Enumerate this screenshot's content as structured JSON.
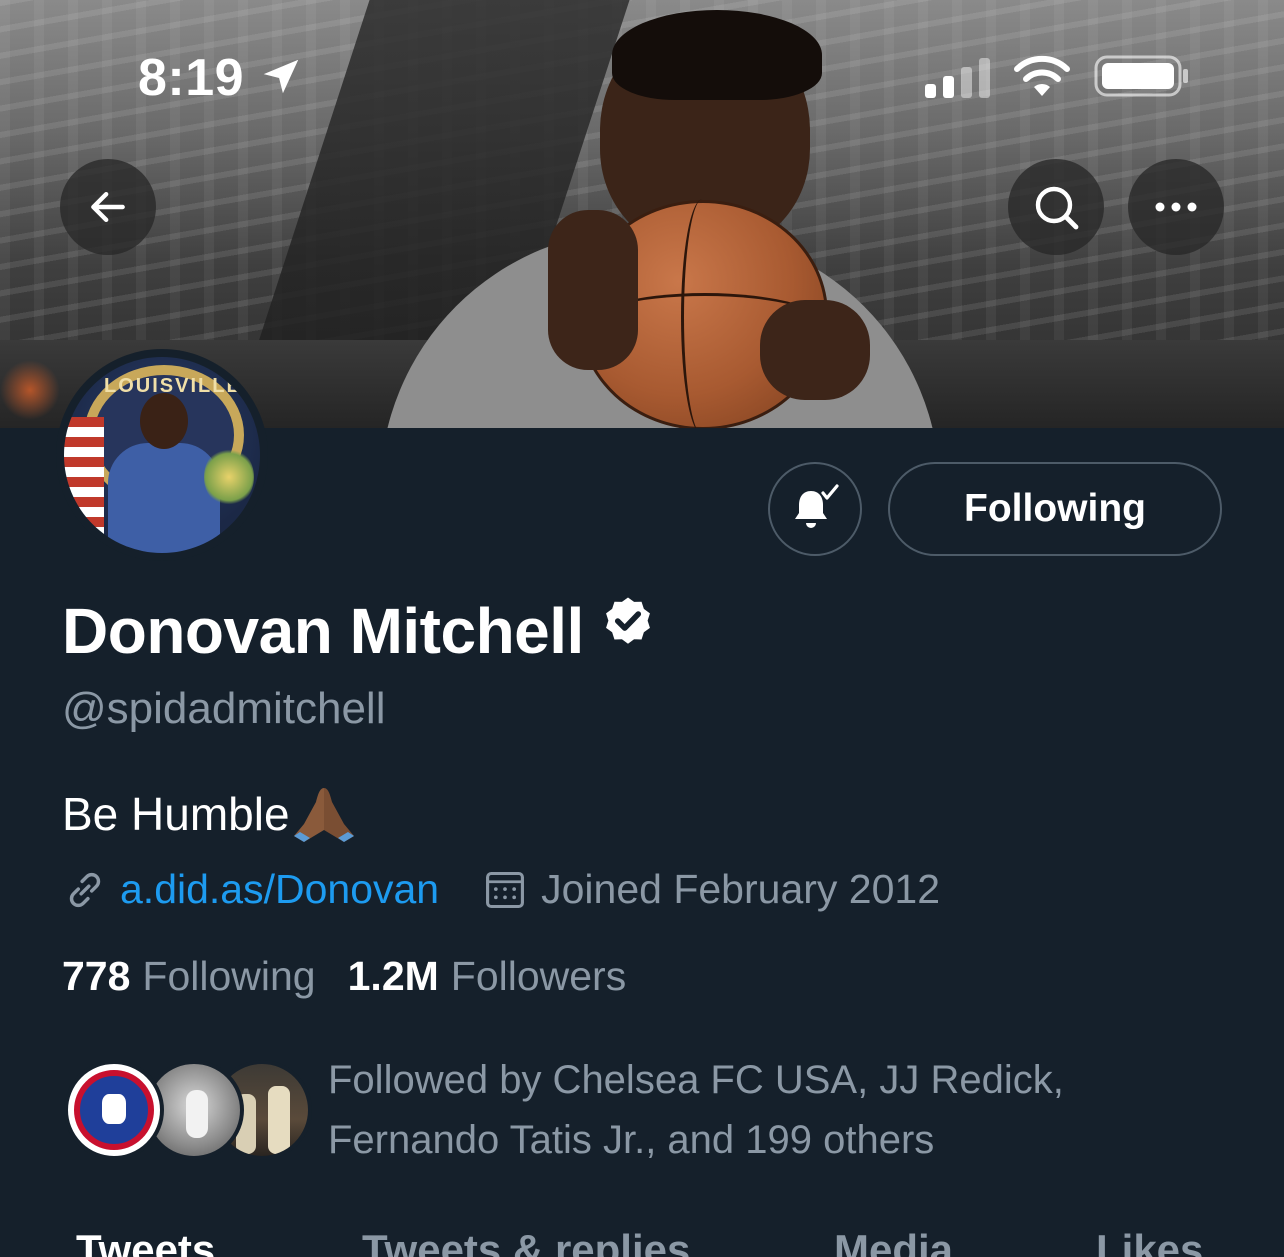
{
  "status_bar": {
    "time": "8:19"
  },
  "profile": {
    "display_name": "Donovan Mitchell",
    "handle": "@spidadmitchell",
    "bio": "Be Humble",
    "bio_emoji": "praying-hands-emoji",
    "website": "a.did.as/Donovan",
    "joined": "Joined February 2012",
    "following_count": "778",
    "following_label": "Following",
    "followers_count": "1.2M",
    "followers_label": "Followers",
    "followed_by": "Followed by Chelsea FC USA, JJ Redick, Fernando Tatis Jr., and 199 others",
    "verified": true,
    "avatar_seal_text": "LOUISVILLE"
  },
  "actions": {
    "following_button": "Following"
  },
  "tabs": [
    {
      "label": "Tweets",
      "active": true
    },
    {
      "label": "Tweets & replies",
      "active": false
    },
    {
      "label": "Media",
      "active": false
    },
    {
      "label": "Likes",
      "active": false
    }
  ],
  "colors": {
    "background": "#15202b",
    "link": "#1d9bf0",
    "secondary_text": "#8b98a5",
    "border": "#4d5b68"
  },
  "icons": {
    "back": "arrow-left-icon",
    "search": "search-icon",
    "more": "more-icon",
    "notify": "bell-check-icon",
    "link": "link-icon",
    "calendar": "calendar-icon",
    "verified": "verified-badge-icon"
  }
}
